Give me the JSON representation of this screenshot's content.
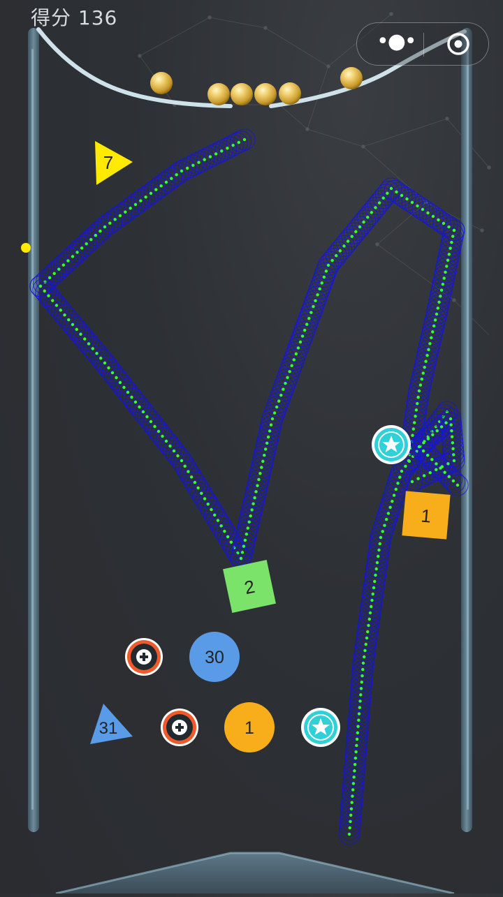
{
  "hud": {
    "score_label": "得分",
    "score_value": "136"
  },
  "capsule": {
    "more_icon": "more-dots-icon",
    "close_icon": "target-close-icon"
  },
  "colors": {
    "background": "#2d3034",
    "rail": "#4f6776",
    "rail_highlight": "#9fb7c4",
    "trail_outline": "#1515d8",
    "trail_dots": "#33ff33",
    "gold_ball": "#d9b84a",
    "yellow": "#ffea00",
    "green_block": "#7be36a",
    "orange_block": "#f7ae1a",
    "blue_block": "#5a9be8",
    "teal_star": "#2fd0d8",
    "plus_ring": "#f05a2a"
  },
  "blocks": [
    {
      "shape": "triangle",
      "value": "7",
      "color": "#ffea00"
    },
    {
      "shape": "square",
      "value": "2",
      "color": "#7be36a"
    },
    {
      "shape": "square",
      "value": "1",
      "color": "#f7ae1a"
    },
    {
      "shape": "circle",
      "value": "30",
      "color": "#5a9be8"
    },
    {
      "shape": "triangle",
      "value": "31",
      "color": "#5a9be8"
    },
    {
      "shape": "circle",
      "value": "1",
      "color": "#f7ae1a"
    }
  ],
  "powerups": [
    {
      "kind": "star",
      "icon": "star-icon"
    },
    {
      "kind": "star",
      "icon": "star-icon"
    },
    {
      "kind": "plus",
      "icon": "plus-icon"
    },
    {
      "kind": "plus",
      "icon": "plus-icon"
    }
  ],
  "balls_in_launcher": 6
}
